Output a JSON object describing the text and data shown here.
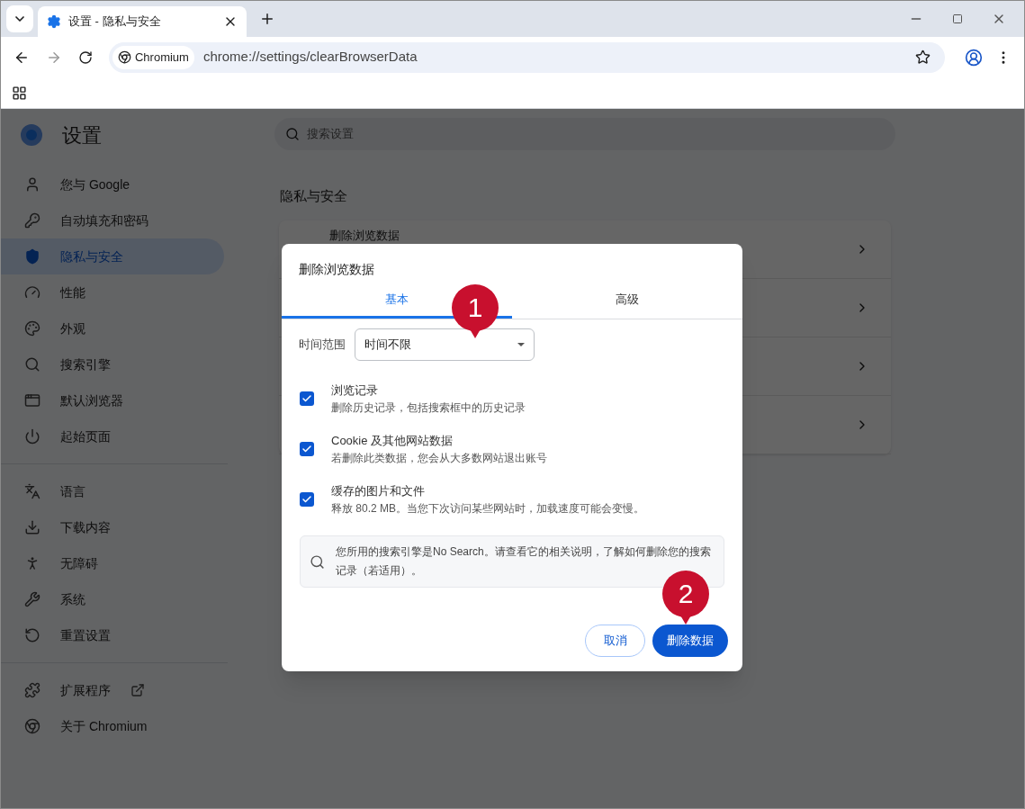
{
  "browser": {
    "tab": {
      "title": "设置 - 隐私与安全",
      "selected": true
    },
    "site_chip": "Chromium",
    "url": "chrome://settings/clearBrowserData"
  },
  "settings": {
    "title": "设置",
    "search": {
      "placeholder": "搜索设置"
    },
    "nav_groups": [
      [
        {
          "label": "您与 Google",
          "selected": false
        },
        {
          "label": "自动填充和密码",
          "selected": false
        },
        {
          "label": "隐私与安全",
          "selected": true
        },
        {
          "label": "性能",
          "selected": false
        },
        {
          "label": "外观",
          "selected": false
        },
        {
          "label": "搜索引擎",
          "selected": false
        },
        {
          "label": "默认浏览器",
          "selected": false
        },
        {
          "label": "起始页面",
          "selected": false
        }
      ],
      [
        {
          "label": "语言",
          "selected": false
        },
        {
          "label": "下载内容",
          "selected": false
        },
        {
          "label": "无障碍",
          "selected": false
        },
        {
          "label": "系统",
          "selected": false
        },
        {
          "label": "重置设置",
          "selected": false
        }
      ],
      [
        {
          "label": "扩展程序",
          "selected": false,
          "external": true
        },
        {
          "label": "关于 Chromium",
          "selected": false,
          "external": false
        }
      ]
    ],
    "section_title": "隐私与安全",
    "card_rows": [
      "删除浏览数据",
      "",
      "",
      ""
    ]
  },
  "dialog": {
    "title": "删除浏览数据",
    "tabs": [
      {
        "label": "基本",
        "selected": true
      },
      {
        "label": "高级",
        "selected": false
      }
    ],
    "time_range": {
      "label": "时间范围",
      "value": "时间不限"
    },
    "options": [
      {
        "title": "浏览记录",
        "description": "删除历史记录，包括搜索框中的历史记录",
        "checked": true
      },
      {
        "title": "Cookie 及其他网站数据",
        "description": "若删除此类数据，您会从大多数网站退出账号",
        "checked": true
      },
      {
        "title": "缓存的图片和文件",
        "description": "释放 80.2 MB。当您下次访问某些网站时，加载速度可能会变慢。",
        "checked": true
      }
    ],
    "notice": "您所用的搜索引擎是No Search。请查看它的相关说明，了解如何删除您的搜索记录（若适用）。",
    "buttons": [
      {
        "label": "取消",
        "kind": "secondary"
      },
      {
        "label": "删除数据",
        "kind": "primary"
      }
    ]
  },
  "callouts": [
    "1",
    "2"
  ]
}
